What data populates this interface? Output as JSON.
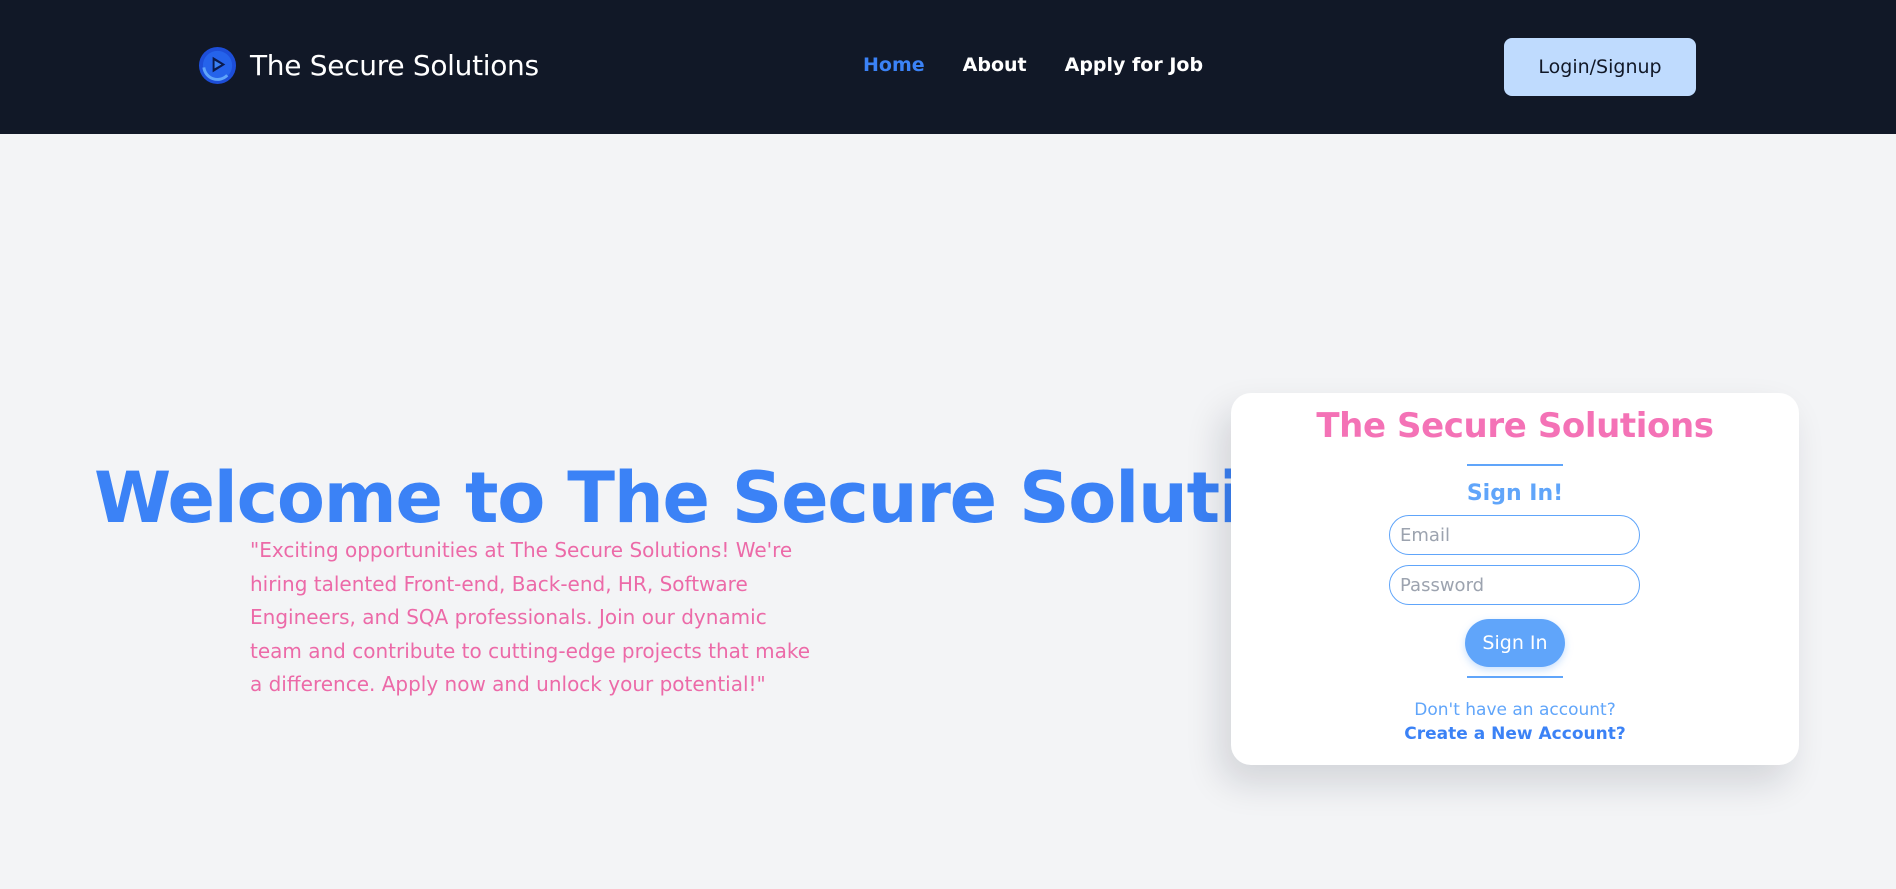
{
  "header": {
    "brand_name": "The Secure Solutions",
    "nav": [
      {
        "label": "Home",
        "active": true
      },
      {
        "label": "About",
        "active": false
      },
      {
        "label": "Apply for Job",
        "active": false
      }
    ],
    "login_button": "Login/Signup"
  },
  "hero": {
    "title": "Welcome to The Secure Solutions",
    "description": "\"Exciting opportunities at The Secure Solutions! We're hiring talented Front-end, Back-end, HR, Software Engineers, and SQA professionals. Join our dynamic team and contribute to cutting-edge projects that make a difference. Apply now and unlock your potential!\""
  },
  "signin_card": {
    "title": "The Secure Solutions",
    "subtitle": "Sign In!",
    "email_placeholder": "Email",
    "password_placeholder": "Password",
    "submit_label": "Sign In",
    "no_account_text": "Don't have an account?",
    "create_account_link": "Create a New Account?"
  },
  "colors": {
    "header_bg": "#111827",
    "page_bg": "#f3f4f6",
    "primary_blue": "#3b82f6",
    "light_blue": "#60a5fa",
    "login_button_bg": "#bfdbfe",
    "accent_pink": "#f472b6"
  },
  "icons": {
    "brand_logo": "play-logo-icon"
  }
}
